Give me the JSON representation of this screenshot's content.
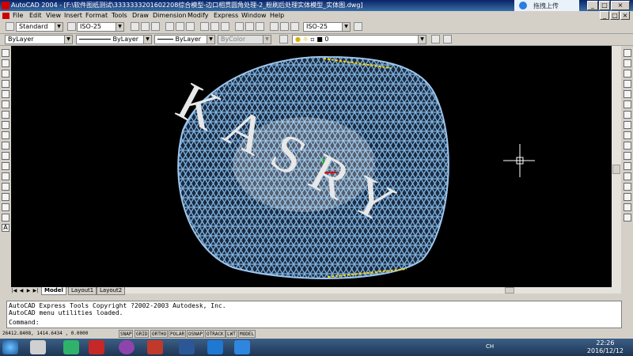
{
  "window": {
    "title": "AutoCAD 2004 - [F:\\软件图纸测试\\3333333201602208综合模型-边口相贯圆角处理-2_粉刷后处理实体模型_实体图.dwg]",
    "cloud_upload_label": "拖拽上传",
    "controls": [
      "_",
      "□",
      "×"
    ]
  },
  "menu": [
    "File",
    "Edit",
    "View",
    "Insert",
    "Format",
    "Tools",
    "Draw",
    "Dimension",
    "Modify",
    "Express",
    "Window",
    "Help"
  ],
  "toolbar1": {
    "text_style": "Standard",
    "dim_style": "ISO-25",
    "dim_style2": "ISO-25"
  },
  "toolbar2": {
    "layer": "ByLayer",
    "linetype": "ByLayer",
    "lineweight": "ByLayer",
    "plotstyle": "ByColor",
    "layer_name": "0"
  },
  "canvas": {
    "watermark": "KASRY",
    "background": "#000000",
    "mesh_color": "#6fa8dc"
  },
  "tabs": {
    "items": [
      "Model",
      "Layout1",
      "Layout2"
    ],
    "active": "Model"
  },
  "command": {
    "line1": "AutoCAD Express Tools Copyright ?2002-2003 Autodesk, Inc.",
    "line2": "AutoCAD menu utilities loaded.",
    "prompt": "Command:"
  },
  "status": {
    "coords": "26412.8408,  1414.6434 , 0.0000",
    "buttons": [
      "SNAP",
      "GRID",
      "ORTHO",
      "POLAR",
      "OSNAP",
      "OTRACK",
      "LWT",
      "MODEL"
    ]
  },
  "taskbar": {
    "tray_lang": "CH",
    "time": "22:26",
    "date": "2016/12/12"
  }
}
